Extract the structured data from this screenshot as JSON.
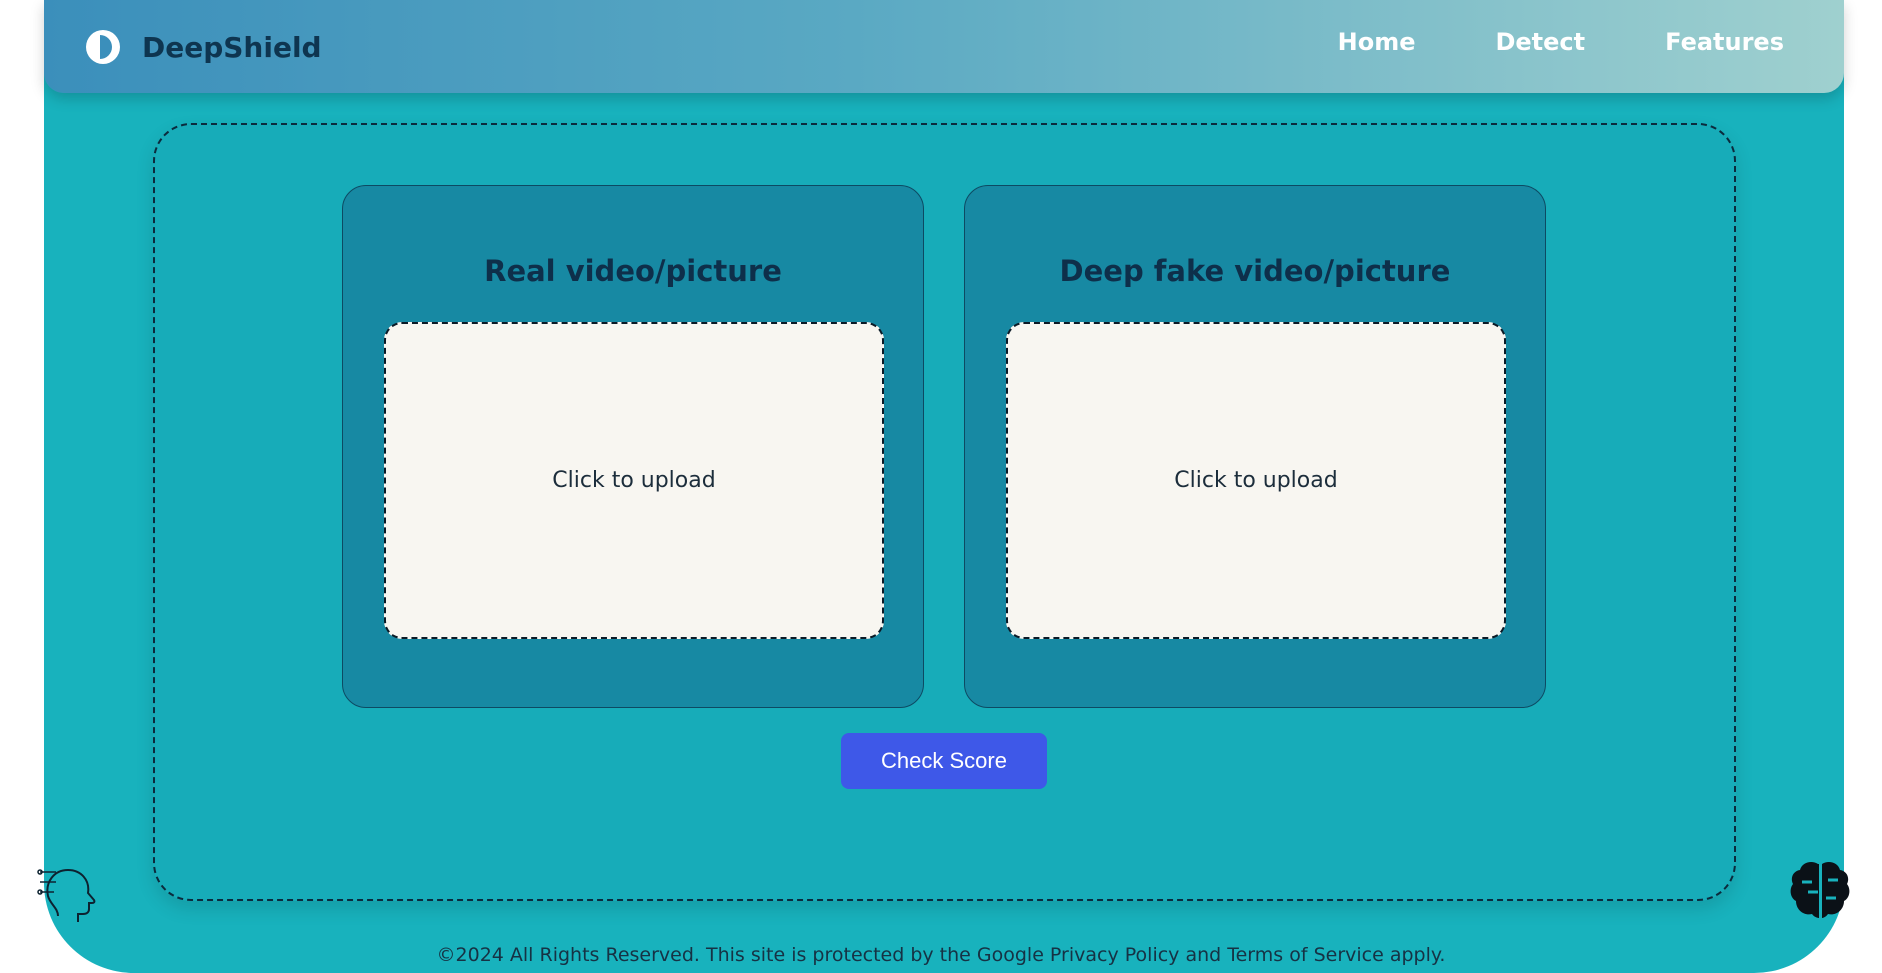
{
  "brand": {
    "name": "DeepShield",
    "logo_icon": "shield-half-circle-icon"
  },
  "nav": {
    "items": [
      {
        "label": "Home"
      },
      {
        "label": "Detect"
      },
      {
        "label": "Features"
      }
    ]
  },
  "main": {
    "cards": [
      {
        "title": "Real video/picture",
        "upload_text": "Click to upload"
      },
      {
        "title": "Deep fake video/picture",
        "upload_text": "Click to upload"
      }
    ],
    "action_label": "Check Score"
  },
  "footer": {
    "text": "©2024 All Rights Reserved. This site is protected by the Google Privacy Policy and Terms of Service apply."
  },
  "decorations": {
    "left_icon": "ai-head-icon",
    "right_icon": "brain-icon"
  },
  "colors": {
    "background": "#18b2bd",
    "card": "#1789a3",
    "button": "#3e58e8",
    "upload_area": "#f8f6f1"
  }
}
